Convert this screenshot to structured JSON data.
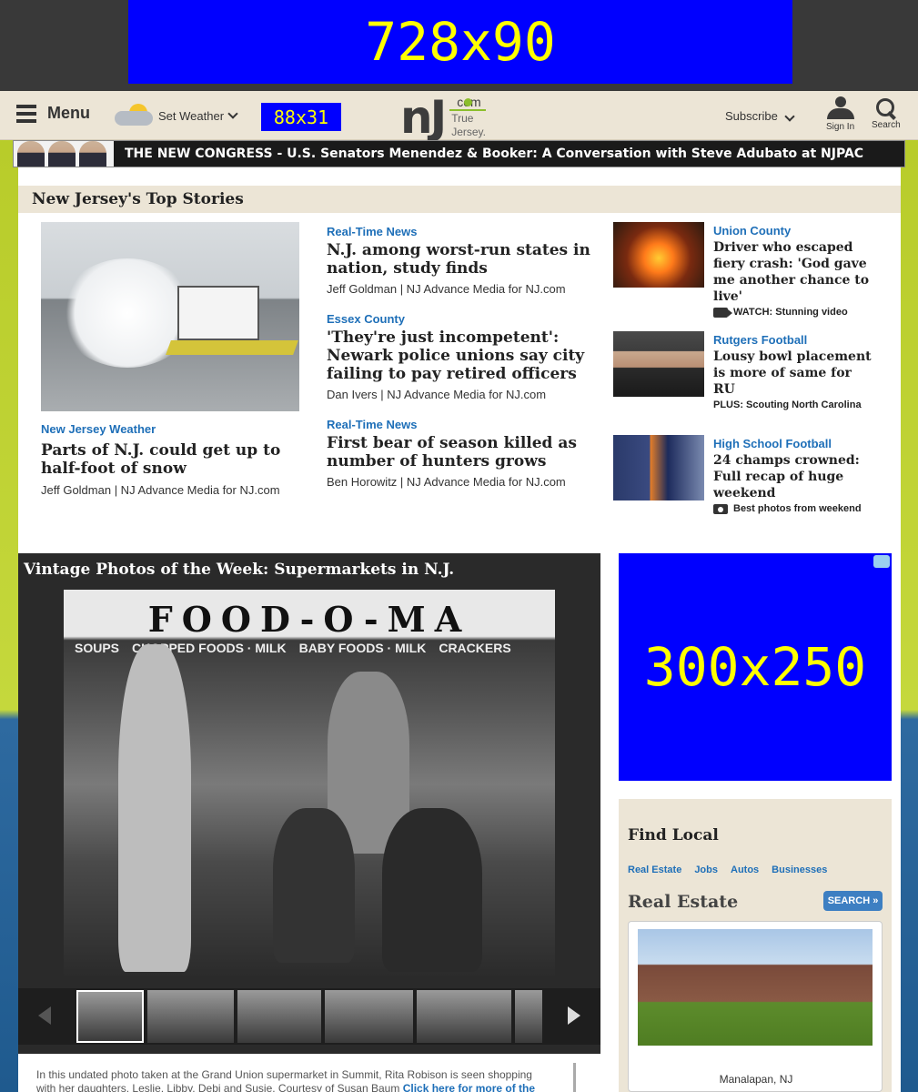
{
  "ads": {
    "leaderboard": "728x90",
    "button": "88x31",
    "rectangle": "300x250"
  },
  "nav": {
    "menu_label": "Menu",
    "weather_label": "Set Weather",
    "logo_com": "com",
    "logo_tagline_1": "True",
    "logo_tagline_2": "Jersey.",
    "subscribe_label": "Subscribe",
    "signin_label": "Sign In",
    "search_label": "Search"
  },
  "banner": {
    "text": "THE NEW CONGRESS - U.S. Senators Menendez & Booker: A Conversation with Steve Adubato at NJPAC"
  },
  "top_stories": {
    "heading": "New Jersey's Top Stories",
    "lead": {
      "kicker": "New Jersey Weather",
      "headline": "Parts of N.J. could get up to half-foot of snow",
      "byline": "Jeff Goldman | NJ Advance Media for NJ.com"
    },
    "middle": [
      {
        "kicker": "Real-Time News",
        "headline": "N.J. among worst-run states in nation, study finds",
        "byline": "Jeff Goldman | NJ Advance Media for NJ.com"
      },
      {
        "kicker": "Essex County",
        "headline": "'They're just incompetent': Newark police unions say city failing to pay retired officers",
        "byline": "Dan Ivers | NJ Advance Media for NJ.com"
      },
      {
        "kicker": "Real-Time News",
        "headline": "First bear of season killed as number of hunters grows",
        "byline": "Ben Horowitz | NJ Advance Media for NJ.com"
      }
    ],
    "right": [
      {
        "kicker": "Union County",
        "headline": "Driver who escaped fiery crash: 'God gave me another chance to live'",
        "extra": "WATCH: Stunning video"
      },
      {
        "kicker": "Rutgers Football",
        "headline": "Lousy bowl placement is more of same for RU",
        "extra": "PLUS: Scouting North Carolina"
      },
      {
        "kicker": "High School Football",
        "headline": "24 champs crowned: Full recap of huge weekend",
        "extra": "Best photos from weekend"
      }
    ]
  },
  "gallery": {
    "title": "Vintage Photos of the Week: Supermarkets in N.J.",
    "sign_text": "FOOD-O-MA",
    "shelf_labels": [
      "SOUPS",
      "CHOPPED FOODS · MILK",
      "BABY FOODS · MILK",
      "CRACKERS"
    ],
    "caption": "In this undated photo taken at the Grand Union supermarket in Summit, Rita Robison is seen shopping with her daughters, Leslie, Libby, Debi and Susie. Courtesy of Susan Baum",
    "caption_link": "Click here for more of the"
  },
  "find_local": {
    "title": "Find Local",
    "tabs": [
      "Real Estate",
      "Jobs",
      "Autos",
      "Businesses"
    ],
    "section_title": "Real Estate",
    "search_button": "SEARCH »",
    "listing_city": "Manalapan, NJ"
  }
}
